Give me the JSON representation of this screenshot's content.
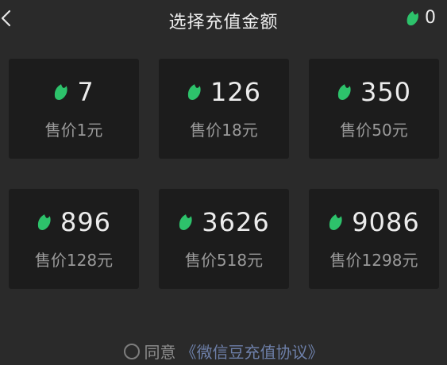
{
  "header": {
    "title": "选择充值金额",
    "balance": "0",
    "back_icon": "chevron-left-icon",
    "balance_icon": "wechat-bean-icon"
  },
  "accent_color": "#2dc26b",
  "options": [
    {
      "amount": "7",
      "price": "售价1元"
    },
    {
      "amount": "126",
      "price": "售价18元"
    },
    {
      "amount": "350",
      "price": "售价50元"
    },
    {
      "amount": "896",
      "price": "售价128元"
    },
    {
      "amount": "3626",
      "price": "售价518元"
    },
    {
      "amount": "9086",
      "price": "售价1298元"
    }
  ],
  "agreement": {
    "prefix": "同意",
    "link": "《微信豆充值协议》",
    "checked": false
  }
}
